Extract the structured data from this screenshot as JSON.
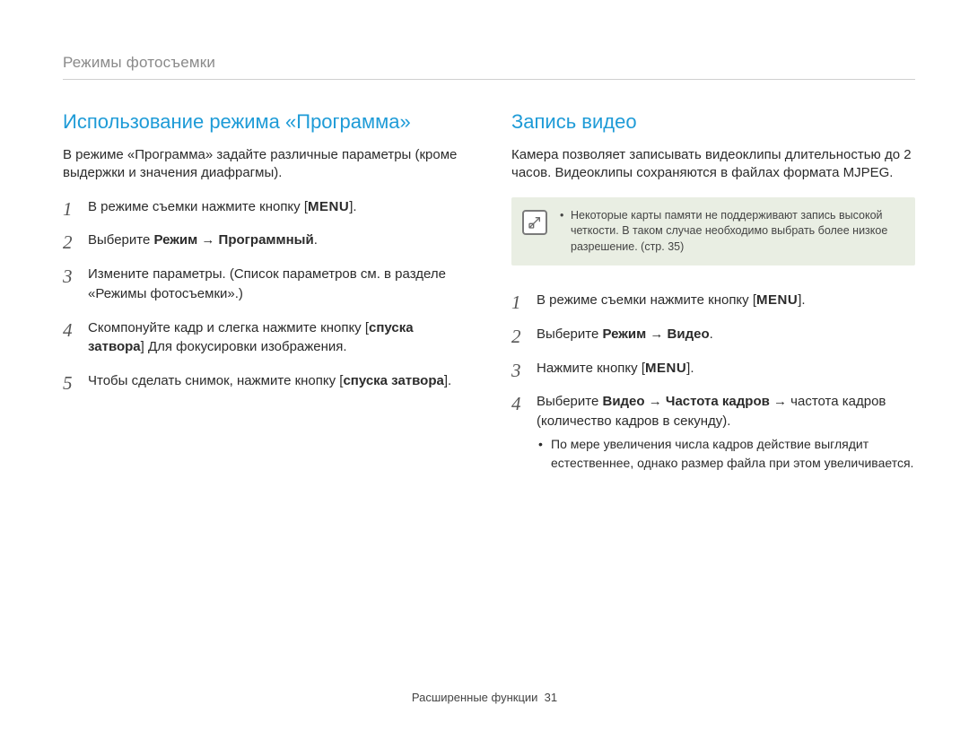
{
  "header": "Режимы фотосъемки",
  "left": {
    "title": "Использование режима «Программа»",
    "intro": "В режиме «Программа» задайте различные параметры (кроме выдержки и значения диафрагмы).",
    "steps": {
      "s1_prefix": "В режиме съемки нажмите кнопку [",
      "s1_menu": "MENU",
      "s1_suffix": "].",
      "s2_prefix": "Выберите ",
      "s2_bold": "Режим → Программный",
      "s2_suffix": ".",
      "s3": "Измените параметры. (Список параметров см. в разделе «Режимы фотосъемки».)",
      "s4_prefix": "Скомпонуйте кадр и слегка нажмите кнопку [",
      "s4_bold": "спуска затвора",
      "s4_suffix": "] Для фокусировки изображения.",
      "s5_prefix": "Чтобы сделать снимок, нажмите кнопку [",
      "s5_bold": "спуска затвора",
      "s5_suffix": "]."
    }
  },
  "right": {
    "title": "Запись видео",
    "intro": "Камера позволяет записывать видеоклипы длительностью до 2 часов. Видеоклипы сохраняются в файлах формата MJPEG.",
    "note": "Некоторые карты памяти не поддерживают запись высокой четкости. В таком случае необходимо выбрать более низкое разрешение. (стр. 35)",
    "steps": {
      "s1_prefix": "В режиме съемки нажмите кнопку [",
      "s1_menu": "MENU",
      "s1_suffix": "].",
      "s2_prefix": "Выберите ",
      "s2_bold": "Режим → Видео",
      "s2_suffix": ".",
      "s3_prefix": "Нажмите кнопку [",
      "s3_menu": "MENU",
      "s3_suffix": "].",
      "s4_prefix": "Выберите ",
      "s4_bold": "Видео → Частота кадров",
      "s4_suffix": " → частота кадров (количество кадров в секунду).",
      "s4_sub": "По мере увеличения числа кадров действие выглядит естественнее, однако размер файла при этом увеличивается."
    }
  },
  "footer_label": "Расширенные функции",
  "footer_page": "31"
}
